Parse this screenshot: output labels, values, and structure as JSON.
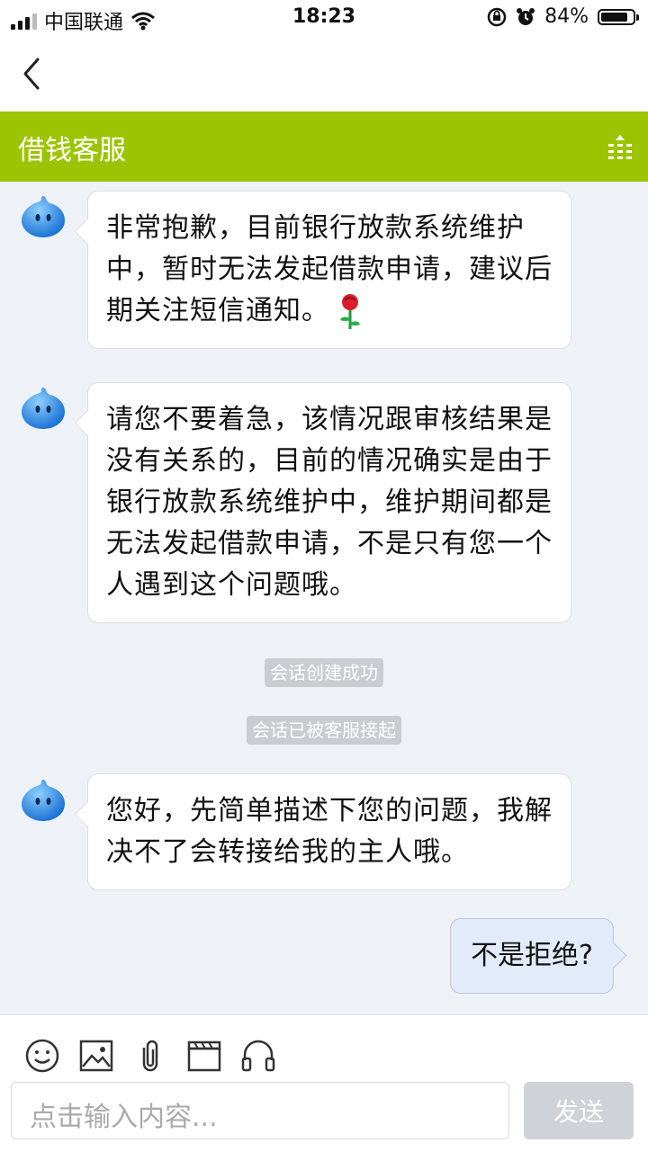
{
  "status": {
    "carrier": "中国联通",
    "time": "18:23",
    "battery": "84%",
    "battery_level": 0.84
  },
  "header": {
    "title": "借钱客服"
  },
  "messages": [
    {
      "from": "agent",
      "text": "非常抱歉，目前银行放款系统维护中，暂时无法发起借款申请，建议后期关注短信通知。"
    },
    {
      "from": "agent",
      "text": "请您不要着急，该情况跟审核结果是没有关系的，目前的情况确实是由于银行放款系统维护中，维护期间都是无法发起借款申请，不是只有您一个人遇到这个问题哦。"
    },
    {
      "from": "system",
      "text": "会话创建成功"
    },
    {
      "from": "system",
      "text": "会话已被客服接起"
    },
    {
      "from": "agent",
      "text": "您好，先简单描述下您的问题，我解决不了会转接给我的主人哦。"
    },
    {
      "from": "user",
      "text": "不是拒绝?"
    }
  ],
  "composer": {
    "placeholder": "点击输入内容...",
    "send_label": "发送"
  }
}
